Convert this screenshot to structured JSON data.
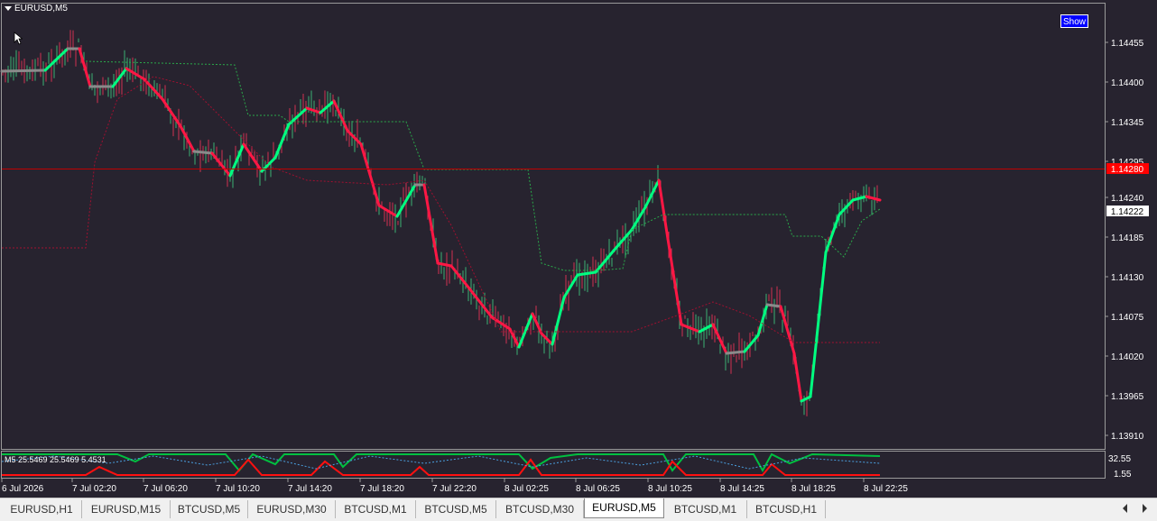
{
  "chart": {
    "title": "EURUSD,M5",
    "show_button": "Show",
    "price_axis": [
      "1.14455",
      "1.14400",
      "1.14345",
      "1.14295",
      "1.14240",
      "1.14185",
      "1.14130",
      "1.14075",
      "1.14020",
      "1.13965",
      "1.13910"
    ],
    "current_price_label": "1.14280",
    "bid_label": "1.14222",
    "time_axis": [
      "6 Jul 2026",
      "7 Jul 02:20",
      "7 Jul 06:20",
      "7 Jul 10:20",
      "7 Jul 14:20",
      "7 Jul 18:20",
      "7 Jul 22:20",
      "8 Jul 02:25",
      "8 Jul 06:25",
      "8 Jul 10:25",
      "8 Jul 14:25",
      "8 Jul 18:25",
      "8 Jul 22:25"
    ],
    "colors": {
      "background": "#27232f",
      "bull": "#00ff80",
      "bear": "#ff1744",
      "neutral": "#8a8a8a",
      "price_line": "#c00000",
      "current_price_box": "#ff0000"
    }
  },
  "oscillator": {
    "label": "M5  25.5469 25.5469 5.4531",
    "axis": [
      "32.55",
      "1.55"
    ]
  },
  "tabs": [
    {
      "label": "EURUSD,H1",
      "active": false
    },
    {
      "label": "EURUSD,M15",
      "active": false
    },
    {
      "label": "BTCUSD,M5",
      "active": false
    },
    {
      "label": "EURUSD,M30",
      "active": false
    },
    {
      "label": "BTCUSD,M1",
      "active": false
    },
    {
      "label": "BTCUSD,M5",
      "active": false
    },
    {
      "label": "BTCUSD,M30",
      "active": false
    },
    {
      "label": "EURUSD,M5",
      "active": true
    },
    {
      "label": "BTCUSD,M1",
      "active": false
    },
    {
      "label": "BTCUSD,H1",
      "active": false
    }
  ]
}
